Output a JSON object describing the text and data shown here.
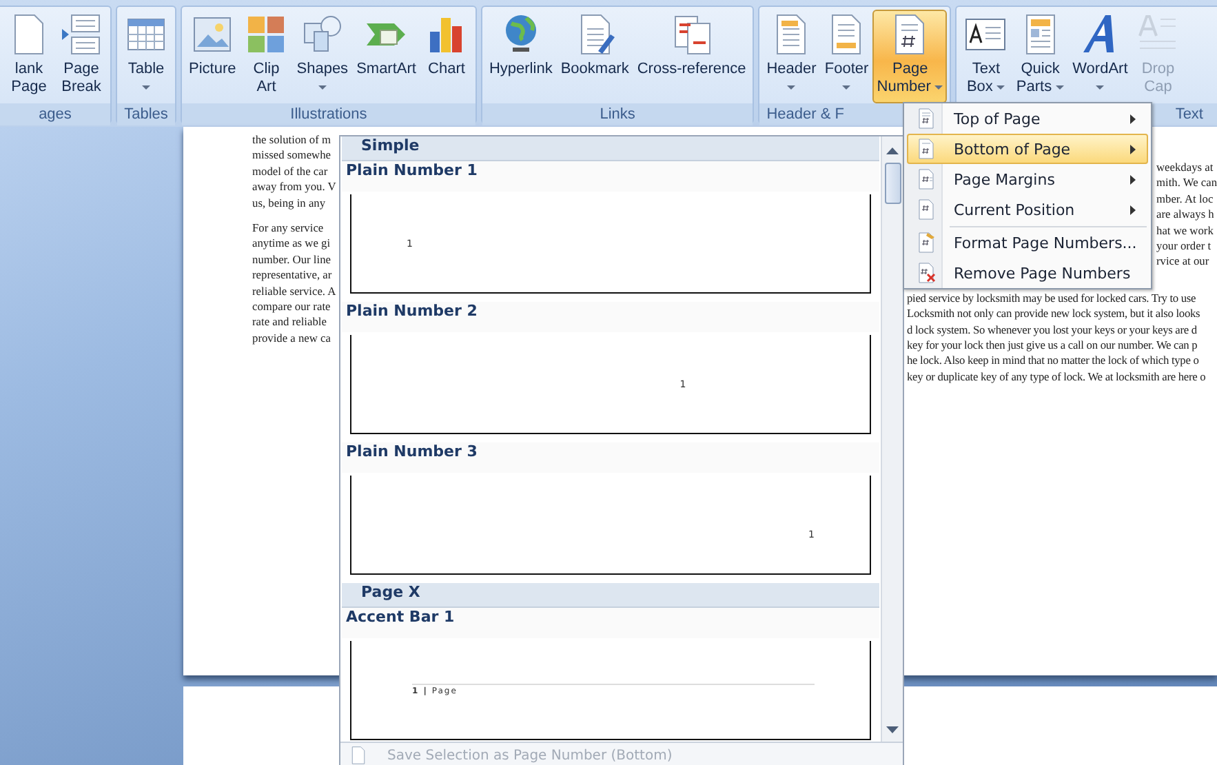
{
  "ribbon": {
    "groups": [
      {
        "label": "ages",
        "buttons": [
          {
            "lines": [
              "lank",
              "Page"
            ],
            "dropdown": false,
            "selected": false,
            "disabled": false
          },
          {
            "lines": [
              "Page",
              "Break"
            ],
            "dropdown": false,
            "selected": false,
            "disabled": false
          }
        ]
      },
      {
        "label": "Tables",
        "buttons": [
          {
            "lines": [
              "Table"
            ],
            "dropdown": true,
            "selected": false,
            "disabled": false
          }
        ]
      },
      {
        "label": "Illustrations",
        "buttons": [
          {
            "lines": [
              "Picture"
            ],
            "dropdown": false,
            "selected": false,
            "disabled": false
          },
          {
            "lines": [
              "Clip",
              "Art"
            ],
            "dropdown": false,
            "selected": false,
            "disabled": false
          },
          {
            "lines": [
              "Shapes"
            ],
            "dropdown": true,
            "selected": false,
            "disabled": false
          },
          {
            "lines": [
              "SmartArt"
            ],
            "dropdown": false,
            "selected": false,
            "disabled": false
          },
          {
            "lines": [
              "Chart"
            ],
            "dropdown": false,
            "selected": false,
            "disabled": false
          }
        ]
      },
      {
        "label": "Links",
        "buttons": [
          {
            "lines": [
              "Hyperlink"
            ],
            "dropdown": false,
            "selected": false,
            "disabled": false
          },
          {
            "lines": [
              "Bookmark"
            ],
            "dropdown": false,
            "selected": false,
            "disabled": false
          },
          {
            "lines": [
              "Cross-reference"
            ],
            "dropdown": false,
            "selected": false,
            "disabled": false
          }
        ]
      },
      {
        "label": "Header & F",
        "buttons": [
          {
            "lines": [
              "Header"
            ],
            "dropdown": true,
            "selected": false,
            "disabled": false
          },
          {
            "lines": [
              "Footer"
            ],
            "dropdown": true,
            "selected": false,
            "disabled": false
          },
          {
            "lines": [
              "Page",
              "Number"
            ],
            "dropdown": true,
            "selected": true,
            "disabled": false
          }
        ]
      },
      {
        "label": "Text",
        "buttons": [
          {
            "lines": [
              "Text",
              "Box"
            ],
            "dropdown": true,
            "selected": false,
            "disabled": false
          },
          {
            "lines": [
              "Quick",
              "Parts"
            ],
            "dropdown": true,
            "selected": false,
            "disabled": false
          },
          {
            "lines": [
              "WordArt"
            ],
            "dropdown": true,
            "selected": false,
            "disabled": false
          },
          {
            "lines": [
              "Drop",
              "Cap"
            ],
            "dropdown": false,
            "selected": false,
            "disabled": true
          }
        ]
      }
    ]
  },
  "document": {
    "left_paragraphs": [
      [
        "the solution of m",
        "missed somewhe",
        "model of the car",
        "away from you. V",
        "us, being in any"
      ],
      [
        "For any service",
        "anytime as we gi",
        "number. Our line",
        "representative, ar",
        "reliable service. A",
        "compare our rate",
        "rate and reliable",
        "provide a new ca"
      ]
    ],
    "right_paragraphs": [
      [
        "weekdays at",
        "mith. We can",
        "mber. At loc",
        "are always h",
        "hat we work",
        "your order t",
        "rvice at our"
      ],
      [
        "pied service by locksmith may be used for locked cars. Try to use",
        "Locksmith not only can provide new lock system, but it also looks",
        "d lock system. So whenever you lost your keys or your keys are d",
        "key for your lock then just give us a call on our number. We can p",
        "he lock. Also keep in mind that no matter the lock of which type o",
        "key or duplicate key of any type of lock. We at locksmith are here o"
      ]
    ]
  },
  "gallery": {
    "sections": [
      {
        "title": "Simple",
        "items": [
          {
            "name": "Plain Number 1",
            "kind": "left",
            "preview": "1"
          },
          {
            "name": "Plain Number 2",
            "kind": "center",
            "preview": "1"
          },
          {
            "name": "Plain Number 3",
            "kind": "right",
            "preview": "1"
          }
        ]
      },
      {
        "title": "Page X",
        "items": [
          {
            "name": "Accent Bar 1",
            "kind": "accent-bar",
            "preview": "**1 |** Page"
          }
        ]
      }
    ],
    "footer": {
      "label": "Save Selection as Page Number (Bottom)",
      "disabled": true
    }
  },
  "menu": {
    "items": [
      {
        "label": "Top of Page",
        "submenu": true,
        "selected": false,
        "separator_before": false
      },
      {
        "label": "Bottom of Page",
        "submenu": true,
        "selected": true,
        "separator_before": false
      },
      {
        "label": "Page Margins",
        "submenu": true,
        "selected": false,
        "separator_before": false
      },
      {
        "label": "Current Position",
        "submenu": true,
        "selected": false,
        "separator_before": false
      },
      {
        "label": "Format Page Numbers...",
        "submenu": false,
        "selected": false,
        "separator_before": true
      },
      {
        "label": "Remove Page Numbers",
        "submenu": false,
        "selected": false,
        "separator_before": false
      }
    ]
  }
}
